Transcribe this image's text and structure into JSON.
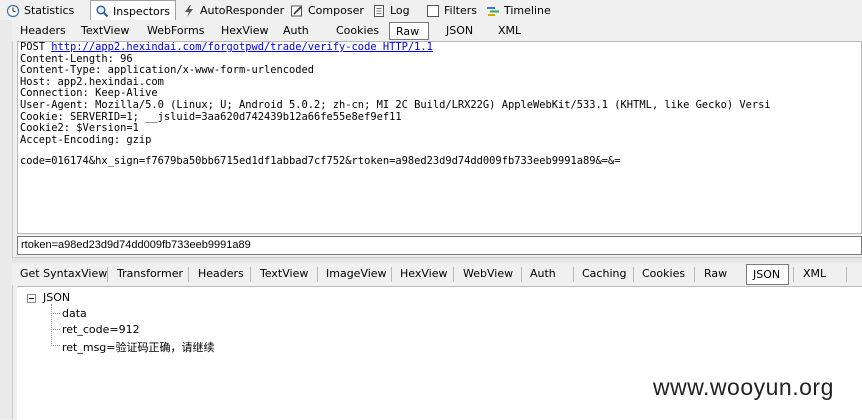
{
  "top_tabs": [
    {
      "label": "Statistics",
      "icon": "clock-icon"
    },
    {
      "label": "Inspectors",
      "icon": "magnifier-icon"
    },
    {
      "label": "AutoResponder",
      "icon": "lightning-icon"
    },
    {
      "label": "Composer",
      "icon": "pencil-icon"
    },
    {
      "label": "Log",
      "icon": "log-icon"
    },
    {
      "label": "Filters",
      "icon": "checkbox-icon"
    },
    {
      "label": "Timeline",
      "icon": "timeline-icon"
    }
  ],
  "request_tabs": [
    "Headers",
    "TextView",
    "WebForms",
    "HexView",
    "Auth",
    "Cookies",
    "Raw",
    "JSON",
    "XML"
  ],
  "request_active_tab": "Raw",
  "raw_request": {
    "method": "POST ",
    "url": "http://app2.hexindai.com/forgotpwd/trade/verify-code HTTP/1.1",
    "lines": [
      "Content-Length: 96",
      "Content-Type: application/x-www-form-urlencoded",
      "Host: app2.hexindai.com",
      "Connection: Keep-Alive",
      "User-Agent: Mozilla/5.0 (Linux; U; Android 5.0.2; zh-cn; MI 2C Build/LRX22G) AppleWebKit/533.1 (KHTML, like Gecko) Versi",
      "Cookie: SERVERID=1; __jsluid=3aa620d742439b12a66fe55e8ef9ef11",
      "Cookie2: $Version=1",
      "Accept-Encoding: gzip"
    ],
    "body": "code=016174&hx_sign=f7679ba50bb6715ed1df1abbad7cf752&rtoken=a98ed23d9d74dd009fb733eeb9991a89&=&="
  },
  "selection_value": "rtoken=a98ed23d9d74dd009fb733eeb9991a89",
  "response_tabs": [
    "Get SyntaxView",
    "Transformer",
    "Headers",
    "TextView",
    "ImageView",
    "HexView",
    "WebView",
    "Auth",
    "Caching",
    "Cookies",
    "Raw",
    "JSON",
    "XML"
  ],
  "response_active_tab": "JSON",
  "json_tree": {
    "root": "JSON",
    "children": [
      "data",
      "ret_code=912",
      "ret_msg=验证码正确，请继续"
    ]
  },
  "watermark": "www.wooyun.org"
}
